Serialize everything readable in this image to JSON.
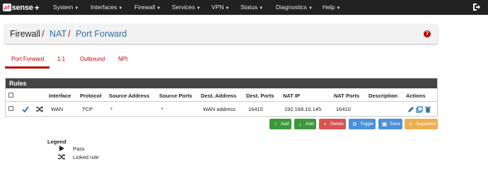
{
  "navbar": {
    "logo": {
      "pf": "pf",
      "sense": "sense",
      "plus": "+"
    },
    "menu": [
      {
        "label": "System"
      },
      {
        "label": "Interfaces"
      },
      {
        "label": "Firewall"
      },
      {
        "label": "Services"
      },
      {
        "label": "VPN"
      },
      {
        "label": "Status"
      },
      {
        "label": "Diagnostics"
      },
      {
        "label": "Help"
      }
    ]
  },
  "breadcrumb": {
    "items": [
      "Firewall",
      "NAT",
      "Port Forward"
    ],
    "separator": "/",
    "help": "?"
  },
  "tabs": [
    {
      "label": "Port Forward",
      "active": true
    },
    {
      "label": "1:1",
      "active": false
    },
    {
      "label": "Outbound",
      "active": false
    },
    {
      "label": "NPt",
      "active": false
    }
  ],
  "rules": {
    "panel_title": "Rules",
    "columns": [
      "Interface",
      "Protocol",
      "Source Address",
      "Source Ports",
      "Dest. Address",
      "Dest. Ports",
      "NAT IP",
      "NAT Ports",
      "Description",
      "Actions"
    ],
    "rows": [
      {
        "interface": "WAN",
        "protocol": "TCP",
        "source_address": "*",
        "source_ports": "*",
        "dest_address": "WAN address",
        "dest_ports": "16410",
        "nat_ip": "192.168.10.145",
        "nat_ports": "16410",
        "description": "",
        "status_icons": [
          "check-icon",
          "shuffle-icon"
        ],
        "action_icons": [
          "pencil-icon",
          "copy-icon",
          "trash-icon"
        ]
      }
    ]
  },
  "buttons": {
    "add_top": "Add",
    "add_bottom": "Add",
    "delete": "Delete",
    "toggle": "Toggle",
    "save": "Save",
    "separator": "Separator"
  },
  "legend": {
    "title": "Legend",
    "items": [
      {
        "icon": "play-icon",
        "label": "Pass"
      },
      {
        "icon": "shuffle-icon",
        "label": "Linked rule"
      }
    ]
  },
  "colors": {
    "navbar": "#212121",
    "accent": "#b00000",
    "link": "#2f6ea5",
    "panel_header": "#444444",
    "btn_green": "#3a9a3a",
    "btn_red": "#d9534f",
    "btn_blue": "#4a90d9",
    "btn_orange": "#f0ad4e"
  }
}
